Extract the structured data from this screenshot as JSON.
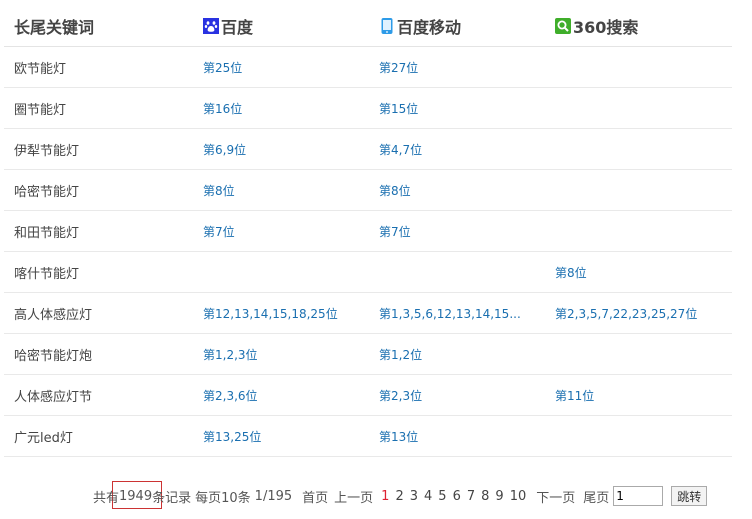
{
  "header": {
    "keyword_col": "长尾关键词",
    "baidu": "百度",
    "baidu_mobile": "百度移动",
    "so360": "360搜索"
  },
  "icons": {
    "baidu": "baidu-paw-icon",
    "baidu_mobile": "mobile-phone-icon",
    "so360": "360-search-icon"
  },
  "colors": {
    "link": "#1a6fb0",
    "current_page": "#dd2233",
    "highlight": "#cc3333"
  },
  "rows": [
    {
      "keyword": "欧节能灯",
      "baidu": "第25位",
      "mobile": "第27位",
      "so": ""
    },
    {
      "keyword": "圈节能灯",
      "baidu": "第16位",
      "mobile": "第15位",
      "so": ""
    },
    {
      "keyword": "伊犁节能灯",
      "baidu": "第6,9位",
      "mobile": "第4,7位",
      "so": ""
    },
    {
      "keyword": "哈密节能灯",
      "baidu": "第8位",
      "mobile": "第8位",
      "so": ""
    },
    {
      "keyword": "和田节能灯",
      "baidu": "第7位",
      "mobile": "第7位",
      "so": ""
    },
    {
      "keyword": "喀什节能灯",
      "baidu": "",
      "mobile": "",
      "so": "第8位"
    },
    {
      "keyword": "高人体感应灯",
      "baidu": "第12,13,14,15,18,25位",
      "mobile": "第1,3,5,6,12,13,14,15...",
      "so": "第2,3,5,7,22,23,25,27位"
    },
    {
      "keyword": "哈密节能灯炮",
      "baidu": "第1,2,3位",
      "mobile": "第1,2位",
      "so": ""
    },
    {
      "keyword": "人体感应灯节",
      "baidu": "第2,3,6位",
      "mobile": "第2,3位",
      "so": "第11位"
    },
    {
      "keyword": "广元led灯",
      "baidu": "第13,25位",
      "mobile": "第13位",
      "so": ""
    }
  ],
  "pager": {
    "total_prefix": "共有",
    "total_count": "1949",
    "total_suffix": "条记录",
    "per_page": "每页10条",
    "page_info": "1/195",
    "first": "首页",
    "prev": "上一页",
    "pages": [
      "1",
      "2",
      "3",
      "4",
      "5",
      "6",
      "7",
      "8",
      "9",
      "10"
    ],
    "current_page": "1",
    "next": "下一页",
    "last": "尾页",
    "jump_value": "1",
    "jump_button": "跳转"
  }
}
